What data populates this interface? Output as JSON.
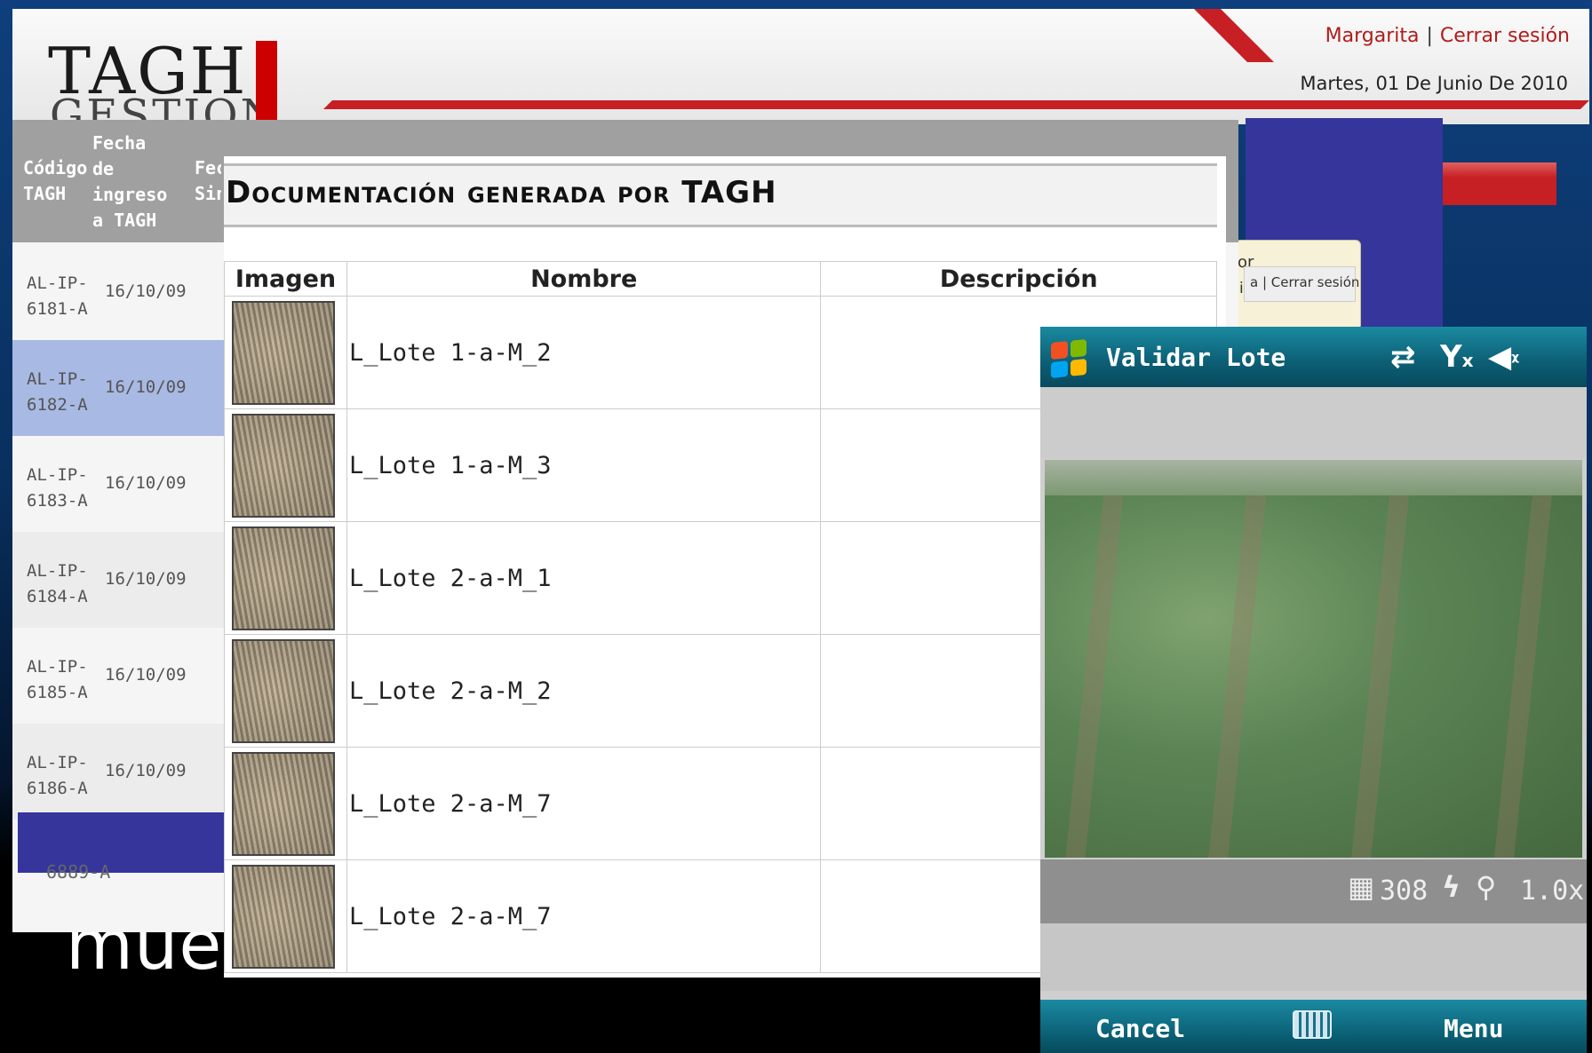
{
  "slide": {
    "caption_fragment": "mues      ,"
  },
  "header": {
    "logo_line1": "TAGH",
    "logo_line2": "GESTION",
    "user": "Margarita",
    "separator": "|",
    "logout": "Cerrar sesión",
    "date": "Martes, 01 De Junio De 2010"
  },
  "lot_table": {
    "headers": [
      "Código TAGH",
      "Fecha de ingreso a TAGH",
      "Fec Sini"
    ],
    "rows": [
      {
        "code": "AL-IP-6181-A",
        "date": "16/10/09",
        "selected": false
      },
      {
        "code": "AL-IP-6182-A",
        "date": "16/10/09",
        "selected": true
      },
      {
        "code": "AL-IP-6183-A",
        "date": "16/10/09",
        "selected": false
      },
      {
        "code": "AL-IP-6184-A",
        "date": "16/10/09",
        "selected": false
      },
      {
        "code": "AL-IP-6185-A",
        "date": "16/10/09",
        "selected": false
      },
      {
        "code": "AL-IP-6186-A",
        "date": "16/10/09",
        "selected": false
      }
    ],
    "partial_code": "6889-A"
  },
  "background_window": {
    "tab_text_1": "or",
    "tab_text_2": "ia",
    "strip_text": "a | Cerrar sesión"
  },
  "doc_popup": {
    "title": "Documentación generada por TAGH",
    "columns": [
      "Imagen",
      "Nombre",
      "Descripción"
    ],
    "rows": [
      {
        "name": "L_Lote 1-a-M_2",
        "description": ""
      },
      {
        "name": "L_Lote 1-a-M_3",
        "description": ""
      },
      {
        "name": "L_Lote 2-a-M_1",
        "description": ""
      },
      {
        "name": "L_Lote 2-a-M_2",
        "description": ""
      },
      {
        "name": "L_Lote 2-a-M_7",
        "description": ""
      },
      {
        "name": "L_Lote 2-a-M_7",
        "description": ""
      }
    ]
  },
  "phone": {
    "title": "Validar Lote",
    "status_icons": [
      "sync-arrows-icon",
      "no-signal-icon",
      "speaker-muted-icon"
    ],
    "camera": {
      "shots_left": "308",
      "zoom": "1.0x"
    },
    "softkeys": {
      "left": "Cancel",
      "right": "Menu"
    }
  },
  "colors": {
    "brand_red": "#c62025",
    "selection_blue": "#a8b9e3",
    "accent_indigo": "#35359c",
    "phone_teal": "#0c5e74",
    "slide_blue": "#0f3f7c"
  }
}
